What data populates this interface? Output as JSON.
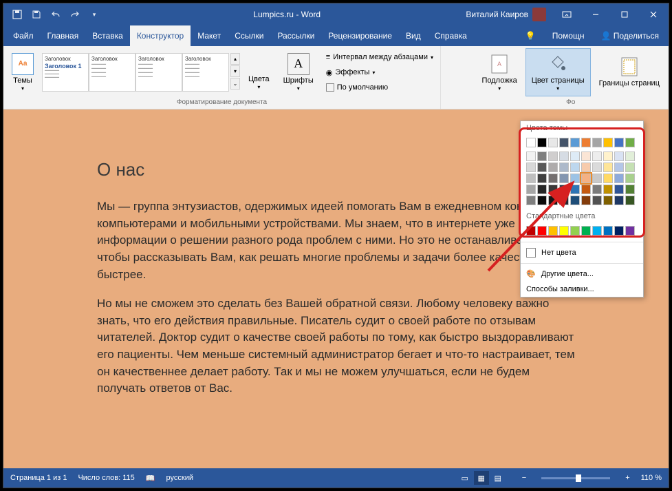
{
  "title": "Lumpics.ru - Word",
  "user": "Виталий Каиров",
  "tabs": [
    "Файл",
    "Главная",
    "Вставка",
    "Конструктор",
    "Макет",
    "Ссылки",
    "Рассылки",
    "Рецензирование",
    "Вид",
    "Справка"
  ],
  "active_tab": 3,
  "help_btn": "Помощн",
  "share_btn": "Поделиться",
  "ribbon": {
    "themes": "Темы",
    "style_head": "Заголовок",
    "style_h1": "Заголовок 1",
    "fmt_label": "Форматирование документа",
    "colors": "Цвета",
    "fonts": "Шрифты",
    "spacing": "Интервал между абзацами",
    "effects": "Эффекты",
    "default": "По умолчанию",
    "watermark": "Подложка",
    "pagecolor": "Цвет страницы",
    "borders": "Границы страниц",
    "bg_label": "Фо"
  },
  "popup": {
    "theme_colors": "Цвета темы",
    "std_colors": "Стандартные цвета",
    "no_color": "Нет цвета",
    "more_colors": "Другие цвета...",
    "fill_methods": "Способы заливки...",
    "theme_row1": [
      "#ffffff",
      "#000000",
      "#e8e8e8",
      "#44546a",
      "#5b9bd5",
      "#ed7d31",
      "#a5a5a5",
      "#ffc000",
      "#4472c4",
      "#70ad47"
    ],
    "theme_grad": [
      [
        "#f2f2f2",
        "#7f7f7f",
        "#d0cece",
        "#d6dce4",
        "#deebf6",
        "#fbe5d5",
        "#ededed",
        "#fff2cc",
        "#d9e2f3",
        "#e2efd9"
      ],
      [
        "#d8d8d8",
        "#595959",
        "#aeabab",
        "#adb9ca",
        "#bdd7ee",
        "#f7cbac",
        "#dbdbdb",
        "#fee599",
        "#b4c6e7",
        "#c5e0b3"
      ],
      [
        "#bfbfbf",
        "#3f3f3f",
        "#757070",
        "#8496b0",
        "#9cc3e5",
        "#f4b183",
        "#c9c9c9",
        "#ffd965",
        "#8eaadb",
        "#a8d08d"
      ],
      [
        "#a5a5a5",
        "#262626",
        "#3a3838",
        "#323f4f",
        "#2e75b5",
        "#c55a11",
        "#7b7b7b",
        "#bf9000",
        "#2f5496",
        "#538135"
      ],
      [
        "#7f7f7f",
        "#0c0c0c",
        "#171616",
        "#222a35",
        "#1e4e79",
        "#833c0b",
        "#525252",
        "#7f6000",
        "#1f3864",
        "#375623"
      ]
    ],
    "std_row": [
      "#c00000",
      "#ff0000",
      "#ffc000",
      "#ffff00",
      "#92d050",
      "#00b050",
      "#00b0f0",
      "#0070c0",
      "#002060",
      "#7030a0"
    ]
  },
  "doc": {
    "heading": "О нас",
    "p1": "Мы — группа энтузиастов, одержимых идеей помогать Вам в ежедневном контакте с компьютерами и мобильными устройствами. Мы знаем, что в интернете уже полно информации о решении разного рода проблем с ними. Но это не останавливает нас, чтобы рассказывать Вам, как решать многие проблемы и задачи более качественно и быстрее.",
    "p2": "Но мы не сможем это сделать без Вашей обратной связи. Любому человеку важно знать, что его действия правильные. Писатель судит о своей работе по отзывам читателей. Доктор судит о качестве своей работы по тому, как быстро выздоравливают его пациенты. Чем меньше системный администратор бегает и что-то настраивает, тем он качественнее делает работу. Так и мы не можем улучшаться, если не будем получать ответов от Вас."
  },
  "status": {
    "page": "Страница 1 из 1",
    "words": "Число слов: 115",
    "lang": "русский",
    "zoom": "110 %"
  }
}
